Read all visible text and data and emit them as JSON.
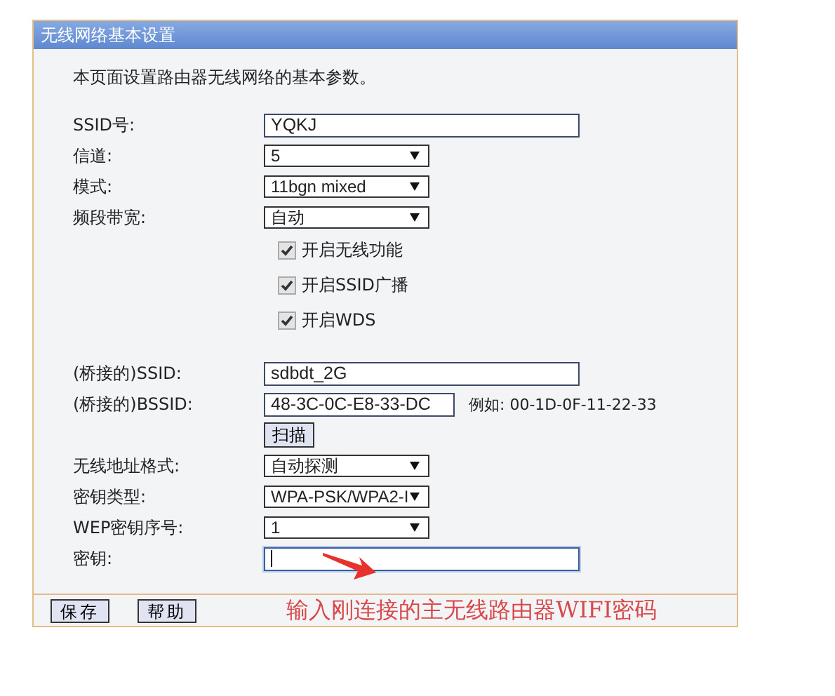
{
  "panel": {
    "title": "无线网络基本设置",
    "intro": "本页面设置路由器无线网络的基本参数。",
    "basic": [
      {
        "kind": "text",
        "label": "SSID号:",
        "value": "YQKJ"
      },
      {
        "kind": "select",
        "label": "信道:",
        "value": "5"
      },
      {
        "kind": "select",
        "label": "模式:",
        "value": "11bgn mixed"
      },
      {
        "kind": "select",
        "label": "频段带宽:",
        "value": "自动"
      },
      {
        "kind": "checkbox",
        "label": "开启无线功能",
        "checked": true
      },
      {
        "kind": "checkbox",
        "label": "开启SSID广播",
        "checked": true
      },
      {
        "kind": "checkbox",
        "label": "开启WDS",
        "checked": true
      }
    ],
    "bridge": [
      {
        "kind": "text",
        "label": "(桥接的)SSID:",
        "value": "sdbdt_2G"
      },
      {
        "kind": "text",
        "label": "(桥接的)BSSID:",
        "value": "48-3C-0C-E8-33-DC",
        "hint": "例如: 00-1D-0F-11-22-33"
      },
      {
        "kind": "button",
        "label": "扫描"
      },
      {
        "kind": "select",
        "label": "无线地址格式:",
        "value": "自动探测"
      },
      {
        "kind": "select",
        "label": "密钥类型:",
        "value": "WPA-PSK/WPA2-I"
      },
      {
        "kind": "select",
        "label": "WEP密钥序号:",
        "value": "1"
      },
      {
        "kind": "text",
        "label": "密钥:",
        "focused": true
      }
    ]
  },
  "footer": {
    "buttons": [
      "保存",
      "帮助"
    ],
    "annotation": "输入刚连接的主无线路由器WIFI密码"
  }
}
